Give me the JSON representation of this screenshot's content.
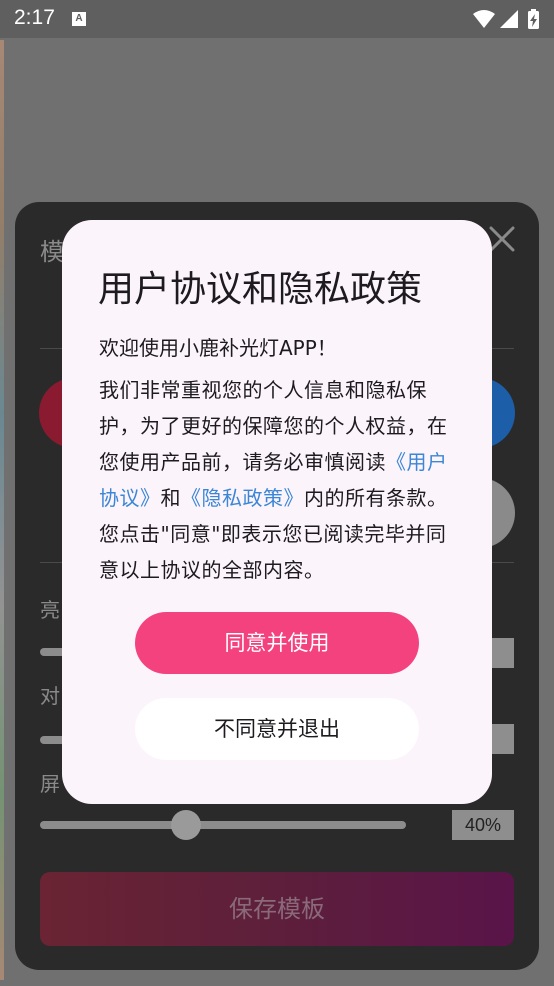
{
  "status_bar": {
    "time": "2:17",
    "notification_icon": "A",
    "icons": [
      "wifi-icon",
      "signal-icon",
      "battery-charging-icon"
    ]
  },
  "panel": {
    "title": "模",
    "close_icon": "close-icon",
    "colors": [
      "#8a1a2f",
      "#1d5ea8",
      "#8a8a8a"
    ],
    "sliders": [
      {
        "label": "亮",
        "value": "%"
      },
      {
        "label": "对",
        "value": "%"
      },
      {
        "label": "屏",
        "value": "40%"
      }
    ],
    "save_label": "保存模板"
  },
  "dialog": {
    "title": "用户协议和隐私政策",
    "welcome": "欢迎使用小鹿补光灯APP！",
    "body_part1": "我们非常重视您的个人信息和隐私保护，为了更好的保障您的个人权益，在您使用产品前，请务必审慎阅读",
    "user_agreement_link": "《用户协议》",
    "connector": "和",
    "privacy_link": "《隐私政策》",
    "body_part2": "内的所有条款。您点击\"同意\"即表示您已阅读完毕并同意以上协议的全部内容。",
    "agree_label": "同意并使用",
    "decline_label": "不同意并退出"
  },
  "colors": {
    "accent": "#f4427f",
    "link": "#3b86d6",
    "dialog_bg": "#fcf4fb"
  }
}
